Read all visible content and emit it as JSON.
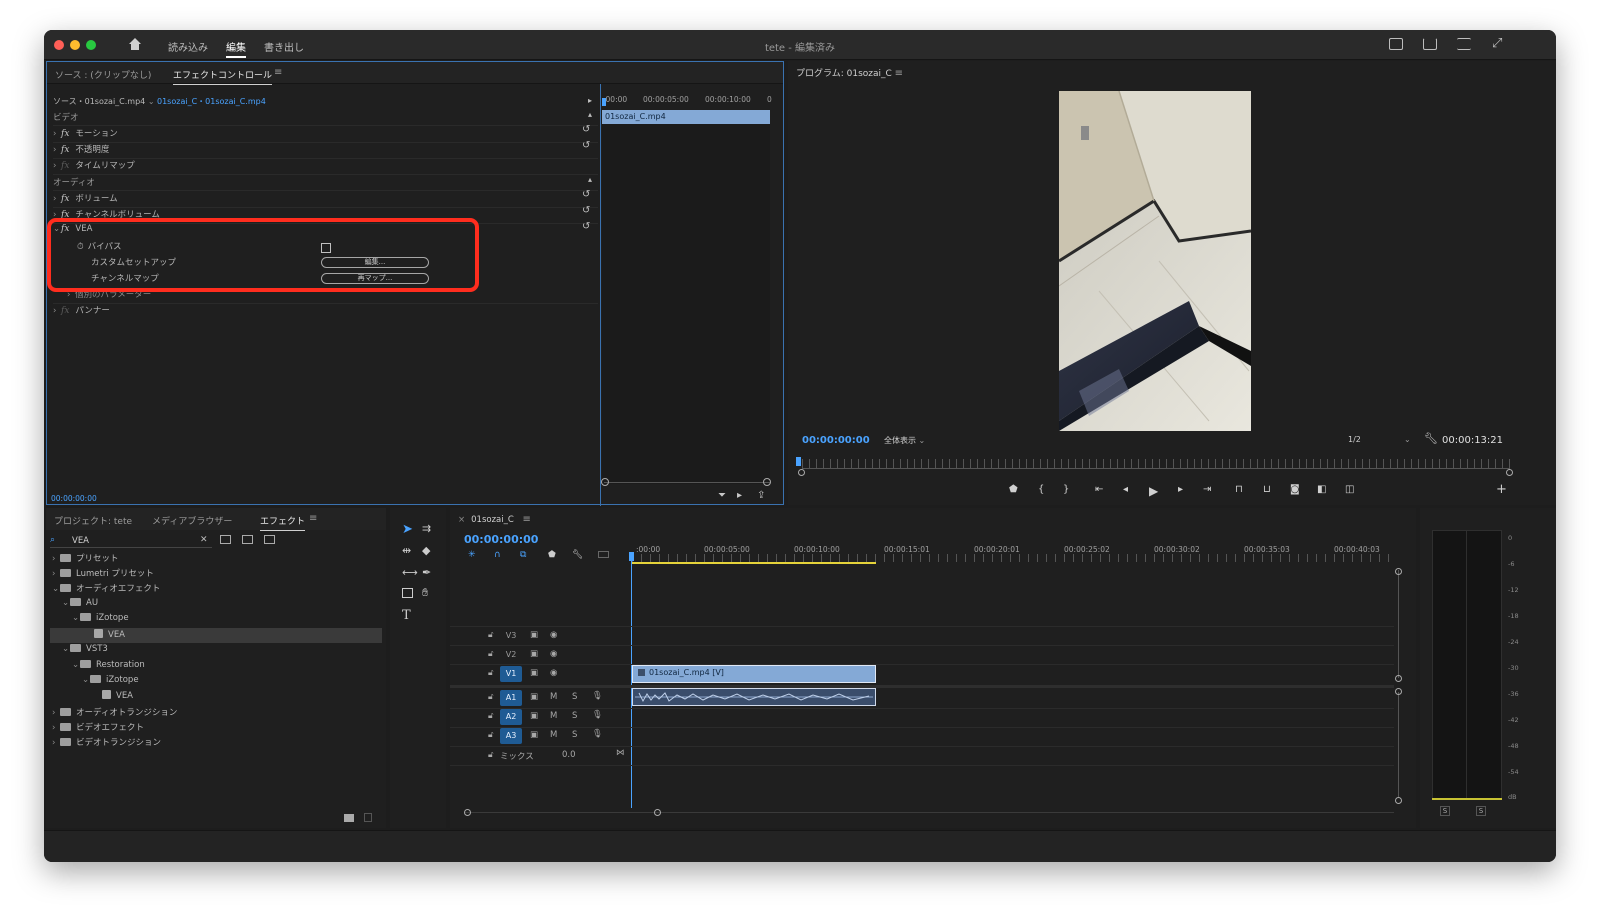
{
  "window": {
    "title": "tete - 編集済み",
    "nav": [
      "読み込み",
      "編集",
      "書き出し"
    ]
  },
  "effect_controls": {
    "tabs": [
      "ソース : (クリップなし)",
      "エフェクトコントロール"
    ],
    "source_label": "ソース・01sozai_C.mp4",
    "sequence_label": "01sozai_C・01sozai_C.mp4",
    "ruler": [
      ":00:00",
      "00:00:05:00",
      "00:00:10:00"
    ],
    "ruler_end": "0",
    "clip_name": "01sozai_C.mp4",
    "rows": {
      "video": "ビデオ",
      "motion": "モーション",
      "opacity": "不透明度",
      "timeremap": "タイムリマップ",
      "audio": "オーディオ",
      "volume": "ボリューム",
      "channel_volume": "チャンネルボリューム",
      "vea": "VEA",
      "bypass": "バイパス",
      "custom_setup": "カスタムセットアップ",
      "custom_setup_btn": "編集...",
      "channel_map": "チャンネルマップ",
      "channel_map_btn": "再マップ...",
      "individual_params": "個別のパラメーター",
      "panner": "パンナー"
    },
    "fx_symbol": "fx",
    "timecode": "00:00:00:00"
  },
  "program": {
    "title": "プログラム: 01sozai_C",
    "timecode": "00:00:00:00",
    "zoom": "全体表示",
    "resolution": "1/2",
    "duration": "00:00:13:21"
  },
  "project": {
    "tabs": [
      "プロジェクト: tete",
      "メディアブラウザー",
      "エフェクト"
    ],
    "search_value": "VEA",
    "tree": {
      "presets": "プリセット",
      "lumetri": "Lumetri プリセット",
      "audio_effects": "オーディオエフェクト",
      "au": "AU",
      "izotope1": "iZotope",
      "vea1": "VEA",
      "vst3": "VST3",
      "restoration": "Restoration",
      "izotope2": "iZotope",
      "vea2": "VEA",
      "audio_transitions": "オーディオトランジション",
      "video_effects": "ビデオエフェクト",
      "video_transitions": "ビデオトランジション"
    }
  },
  "timeline": {
    "tab": "01sozai_C",
    "timecode": "00:00:00:00",
    "ruler": [
      ":00:00",
      "00:00:05:00",
      "00:00:10:00",
      "00:00:15:01",
      "00:00:20:01",
      "00:00:25:02",
      "00:00:30:02",
      "00:00:35:03",
      "00:00:40:03"
    ],
    "tracks": {
      "v3": "V3",
      "v2": "V2",
      "v1": "V1",
      "a1": "A1",
      "a2": "A2",
      "a3": "A3",
      "mute": "M",
      "solo": "S",
      "mix": "ミックス",
      "mix_value": "0.0"
    },
    "video_clip": "01sozai_C.mp4 [V]"
  },
  "meters": {
    "scale": [
      "0",
      "-6",
      "-12",
      "-18",
      "-24",
      "-30",
      "-36",
      "-42",
      "-48",
      "-54",
      "dB"
    ],
    "solo_left": "S",
    "solo_right": "S"
  },
  "colors": {
    "accent": "#4aa3ff",
    "highlight": "#ff2d1e",
    "clip": "#84a9d6"
  }
}
